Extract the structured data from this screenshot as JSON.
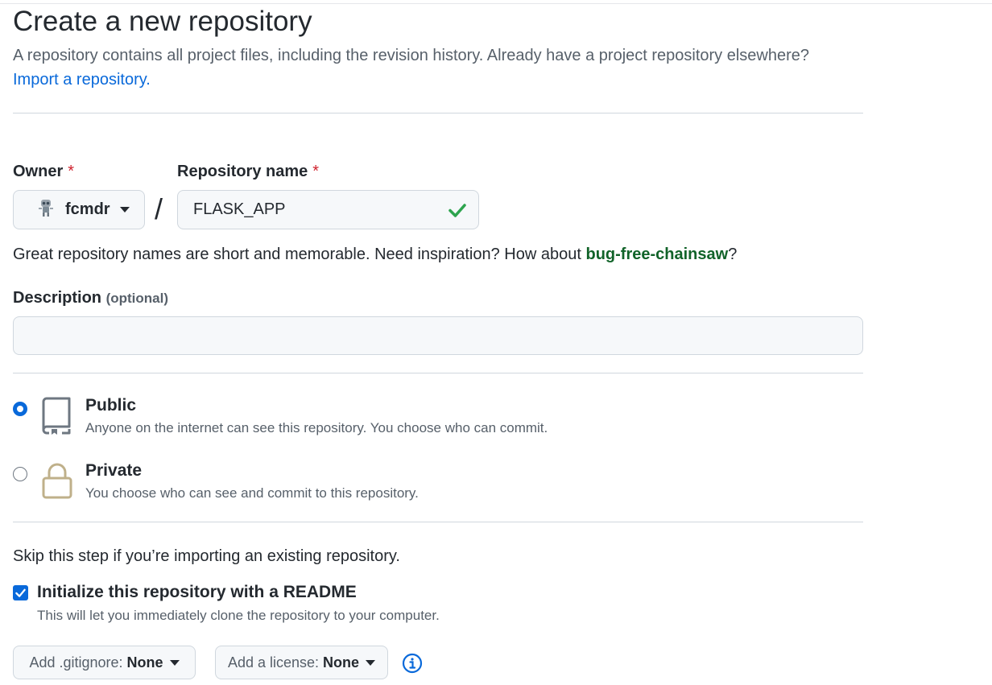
{
  "header": {
    "title": "Create a new repository",
    "subtitle": "A repository contains all project files, including the revision history. Already have a project repository elsewhere?",
    "import_link": "Import a repository."
  },
  "owner": {
    "label": "Owner",
    "required_mark": "*",
    "value": "fcmdr",
    "avatar_icon": "robot-avatar-icon"
  },
  "separator": "/",
  "repo_name": {
    "label": "Repository name",
    "required_mark": "*",
    "value": "FLASK_APP",
    "valid_icon": "check-icon",
    "valid_color": "#2da44e"
  },
  "name_hint": {
    "prefix": "Great repository names are short and memorable. Need inspiration? How about ",
    "suggestion": "bug-free-chainsaw",
    "suffix": "?"
  },
  "description": {
    "label": "Description",
    "optional": "(optional)",
    "value": ""
  },
  "visibility": {
    "selected": "public",
    "options": [
      {
        "id": "public",
        "label": "Public",
        "description": "Anyone on the internet can see this repository. You choose who can commit.",
        "icon": "repo-icon"
      },
      {
        "id": "private",
        "label": "Private",
        "description": "You choose who can see and commit to this repository.",
        "icon": "lock-icon"
      }
    ]
  },
  "initialize": {
    "skip_note": "Skip this step if you’re importing an existing repository.",
    "readme_label": "Initialize this repository with a README",
    "readme_desc": "This will let you immediately clone the repository to your computer.",
    "readme_checked": true
  },
  "gitignore": {
    "prefix": "Add .gitignore:",
    "value": "None"
  },
  "license": {
    "prefix": "Add a license:",
    "value": "None"
  },
  "info_icon": "info-icon",
  "colors": {
    "accent": "#0969da",
    "required": "#cf222e",
    "success": "#116329",
    "lock_tan": "#bfb08a"
  }
}
